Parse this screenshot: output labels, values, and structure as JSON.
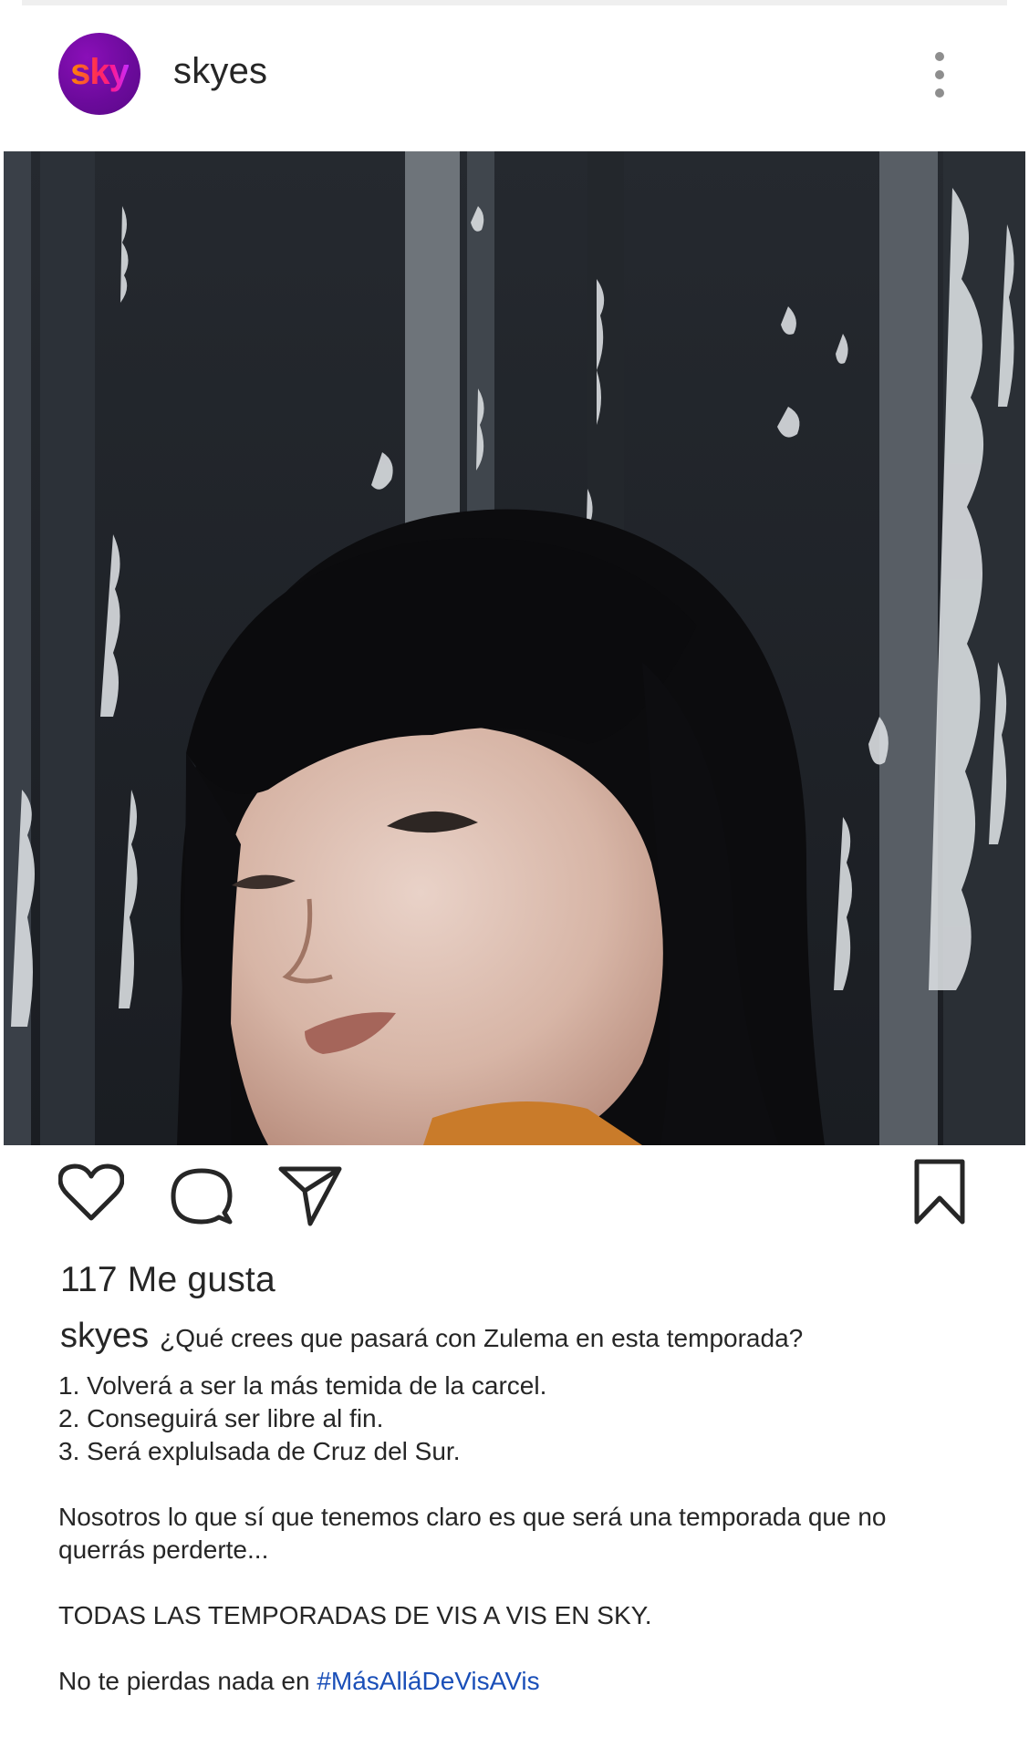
{
  "post": {
    "username": "skyes",
    "avatar_text": "sky",
    "likes_text": "117 Me gusta",
    "caption_user": "skyes",
    "caption_first_line": "¿Qué crees que pasará con Zulema en esta temporada?",
    "lines": {
      "opt1": "1. Volverá a ser la más temida de la carcel.",
      "opt2": "2. Conseguirá ser libre al fin.",
      "opt3": "3. Será explulsada de Cruz del Sur.",
      "para1a": "Nosotros lo que sí que tenemos claro es que será una temporada que no",
      "para1b": "querrás perderte...",
      "para2": "TODAS LAS TEMPORADAS DE VIS A VIS EN SKY.",
      "para3_prefix": "No te pierdas nada en ",
      "hashtag": "#MásAlláDeVisAVis"
    }
  },
  "icons": {
    "more": "more-vertical-icon",
    "like": "heart-icon",
    "comment": "comment-icon",
    "share": "send-icon",
    "save": "bookmark-icon"
  },
  "colors": {
    "avatar_bg": "#6a0a9a",
    "text": "#262626",
    "hashtag": "#1a4fb8"
  }
}
